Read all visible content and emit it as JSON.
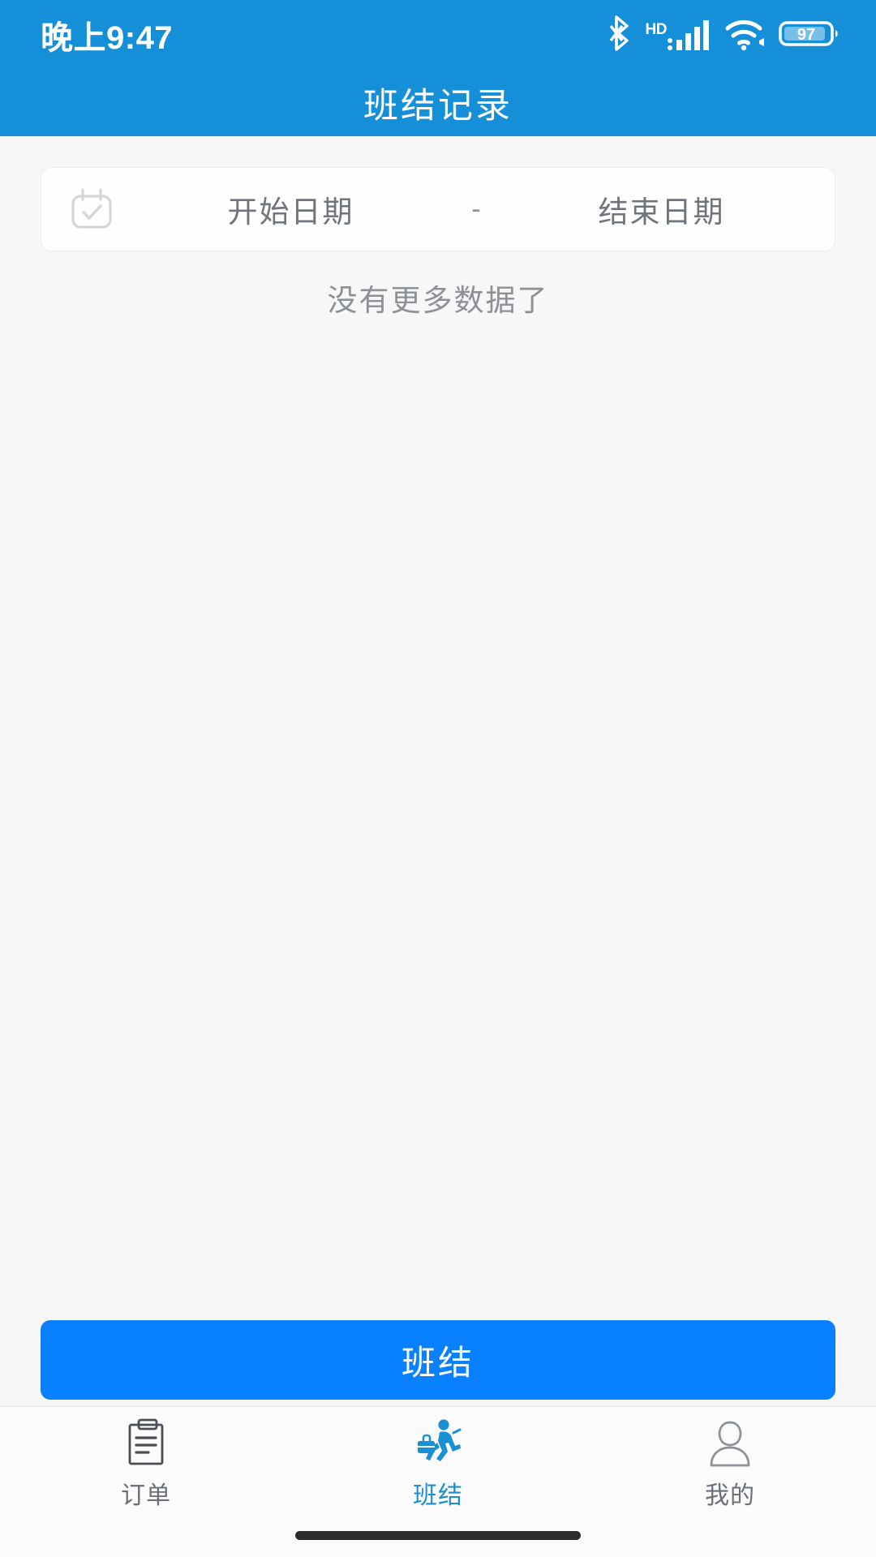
{
  "status_bar": {
    "clock": "晚上9:47",
    "battery_percent": "97",
    "network_label": "HD",
    "icons": [
      "bluetooth-icon",
      "hd-icon",
      "signal-icon",
      "wifi-icon",
      "battery-icon"
    ]
  },
  "header": {
    "title": "班结记录",
    "background_color": "#1590d8",
    "text_color": "#ffffff"
  },
  "filter": {
    "icon": "calendar-check-icon",
    "start_date_placeholder": "开始日期",
    "separator": "-",
    "end_date_placeholder": "结束日期",
    "start_date_value": "",
    "end_date_value": ""
  },
  "list": {
    "empty_text": "没有更多数据了",
    "items": []
  },
  "primary_action": {
    "label": "班结",
    "color": "#0880ff"
  },
  "tabbar": {
    "active_color": "#1a8fd4",
    "inactive_color": "#6b6f76",
    "items": [
      {
        "label": "订单",
        "icon": "clipboard-icon",
        "active": false
      },
      {
        "label": "班结",
        "icon": "running-person-icon",
        "active": true
      },
      {
        "label": "我的",
        "icon": "person-icon",
        "active": false
      }
    ]
  },
  "page_background": "#f7f7f7"
}
